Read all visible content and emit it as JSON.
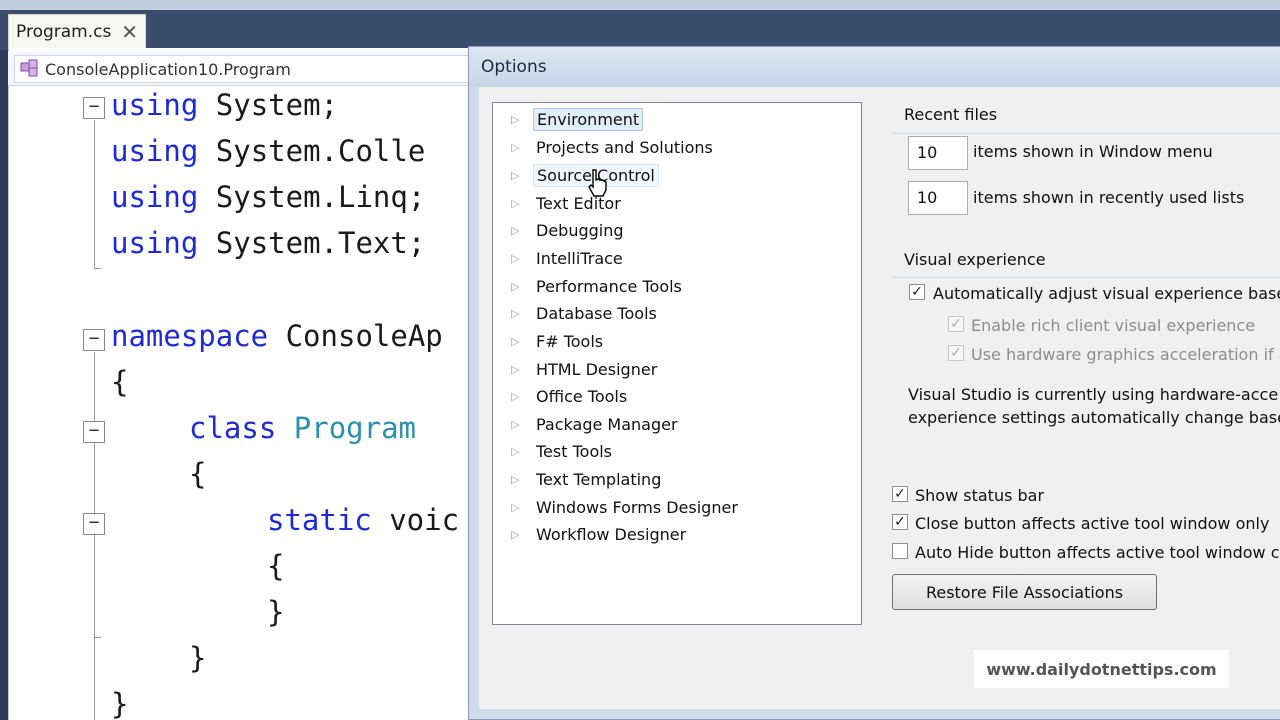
{
  "editor": {
    "tab_label": "Program.cs",
    "nav_combo": "ConsoleApplication10.Program",
    "lines": [
      {
        "kw": "using",
        "rest": " System;"
      },
      {
        "kw": "using",
        "rest": " System.Colle"
      },
      {
        "kw": "using",
        "rest": " System.Linq;"
      },
      {
        "kw": "using",
        "rest": " System.Text;"
      },
      {
        "kw": "namespace",
        "rest": " ConsoleAp"
      },
      {
        "rest": "{"
      },
      {
        "kw": "class",
        "ty": "Program"
      },
      {
        "rest": "{"
      },
      {
        "kw": "static",
        "rest": " voic"
      },
      {
        "rest": "{"
      },
      {
        "rest": "}"
      },
      {
        "rest": "}"
      },
      {
        "rest": "}"
      }
    ]
  },
  "dialog": {
    "title": "Options",
    "tree": [
      "Environment",
      "Projects and Solutions",
      "Source Control",
      "Text Editor",
      "Debugging",
      "IntelliTrace",
      "Performance Tools",
      "Database Tools",
      "F# Tools",
      "HTML Designer",
      "Office Tools",
      "Package Manager",
      "Test Tools",
      "Text Templating",
      "Windows Forms Designer",
      "Workflow Designer"
    ],
    "selected_item": "Environment",
    "hovered_item": "Source Control",
    "recent_files": {
      "heading": "Recent files",
      "window_menu_value": "10",
      "window_menu_label": "items shown in Window menu",
      "recent_lists_value": "10",
      "recent_lists_label": "items shown in recently used lists"
    },
    "visual_experience": {
      "heading": "Visual experience",
      "auto_adjust_label": "Automatically adjust visual experience base",
      "auto_adjust_checked": true,
      "rich_client_label": "Enable rich client visual experience",
      "hw_accel_label": "Use hardware graphics acceleration if a",
      "info_line1": "Visual Studio is currently using hardware-acce",
      "info_line2": "experience settings automatically change base"
    },
    "show_status_bar": {
      "label": "Show status bar",
      "checked": true
    },
    "close_button": {
      "label": "Close button affects active tool window only",
      "checked": true
    },
    "auto_hide": {
      "label": "Auto Hide button affects active tool window c",
      "checked": false
    },
    "restore_button": "Restore File Associations"
  },
  "watermark": "www.dailydotnettips.com",
  "colors": {
    "keyword": "#1f2ad6",
    "type": "#2b91af",
    "selection": "#e3eefb"
  }
}
